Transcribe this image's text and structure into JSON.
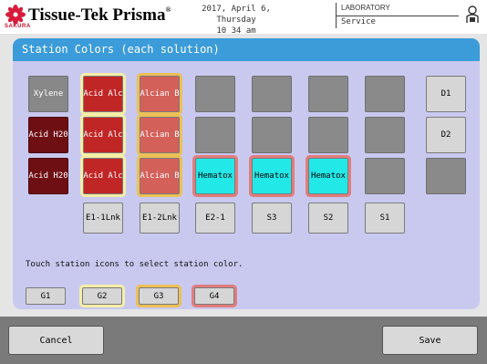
{
  "header": {
    "logo_sub": "SAKURA",
    "brand": "Tissue-Tek Prisma",
    "brand_mark": "®",
    "date": "2017, April 6, Thursday",
    "time": "10 34 am",
    "location": "LABORATORY",
    "mode": "Service",
    "logo_icon": "sakura-flower-icon",
    "user_icon": "user-lock-icon"
  },
  "panel": {
    "title": "Station Colors (each solution)",
    "hint": "Touch station icons to select station color."
  },
  "stations": {
    "row1": [
      {
        "label": "Xylene",
        "style": "xylene"
      },
      {
        "label": "Acid Alc",
        "style": "red",
        "outline": "yellow"
      },
      {
        "label": "Alcian B",
        "style": "pink",
        "outline": "gold"
      },
      {
        "label": "",
        "style": "empty"
      },
      {
        "label": "",
        "style": "empty"
      },
      {
        "label": "",
        "style": "empty"
      },
      {
        "label": "",
        "style": "empty"
      },
      {
        "label": "D1",
        "style": "gray"
      }
    ],
    "row2": [
      {
        "label": "Acid H20",
        "style": "dark"
      },
      {
        "label": "Acid Alc",
        "style": "red",
        "outline": "yellow"
      },
      {
        "label": "Alcian B",
        "style": "pink",
        "outline": "gold"
      },
      {
        "label": "",
        "style": "empty"
      },
      {
        "label": "",
        "style": "empty"
      },
      {
        "label": "",
        "style": "empty"
      },
      {
        "label": "",
        "style": "empty"
      },
      {
        "label": "D2",
        "style": "gray"
      }
    ],
    "row3": [
      {
        "label": "Acid H20",
        "style": "dark"
      },
      {
        "label": "Acid Alc",
        "style": "red",
        "outline": "yellow"
      },
      {
        "label": "Alcian B",
        "style": "pink",
        "outline": "gold"
      },
      {
        "label": "Hematox",
        "style": "cyan",
        "outline": "salmon"
      },
      {
        "label": "Hematox",
        "style": "cyan",
        "outline": "salmon"
      },
      {
        "label": "Hematox",
        "style": "cyan",
        "outline": "salmon"
      },
      {
        "label": "",
        "style": "empty"
      },
      {
        "label": "",
        "style": "empty"
      }
    ],
    "bottom_labels": [
      "E1-1Lnk",
      "E1-2Lnk",
      "E2-1",
      "S3",
      "S2",
      "S1"
    ]
  },
  "groups": [
    {
      "label": "G1",
      "outline": ""
    },
    {
      "label": "G2",
      "outline": "yellow"
    },
    {
      "label": "G3",
      "outline": "gold"
    },
    {
      "label": "G4",
      "outline": "salmon"
    }
  ],
  "colors": {
    "title_bar": "#3b9cd9",
    "panel": "#c9c9f0",
    "acid_alc": "#c12626",
    "alcian_b": "#d4605a",
    "hematox": "#22e8e8",
    "acid_h20": "#6e0f14",
    "empty_station": "#8a8a8a",
    "outline_g2": "#f6eea6",
    "outline_g3": "#ecc056",
    "outline_g4": "#e27d7d"
  },
  "footer": {
    "cancel": "Cancel",
    "save": "Save"
  }
}
